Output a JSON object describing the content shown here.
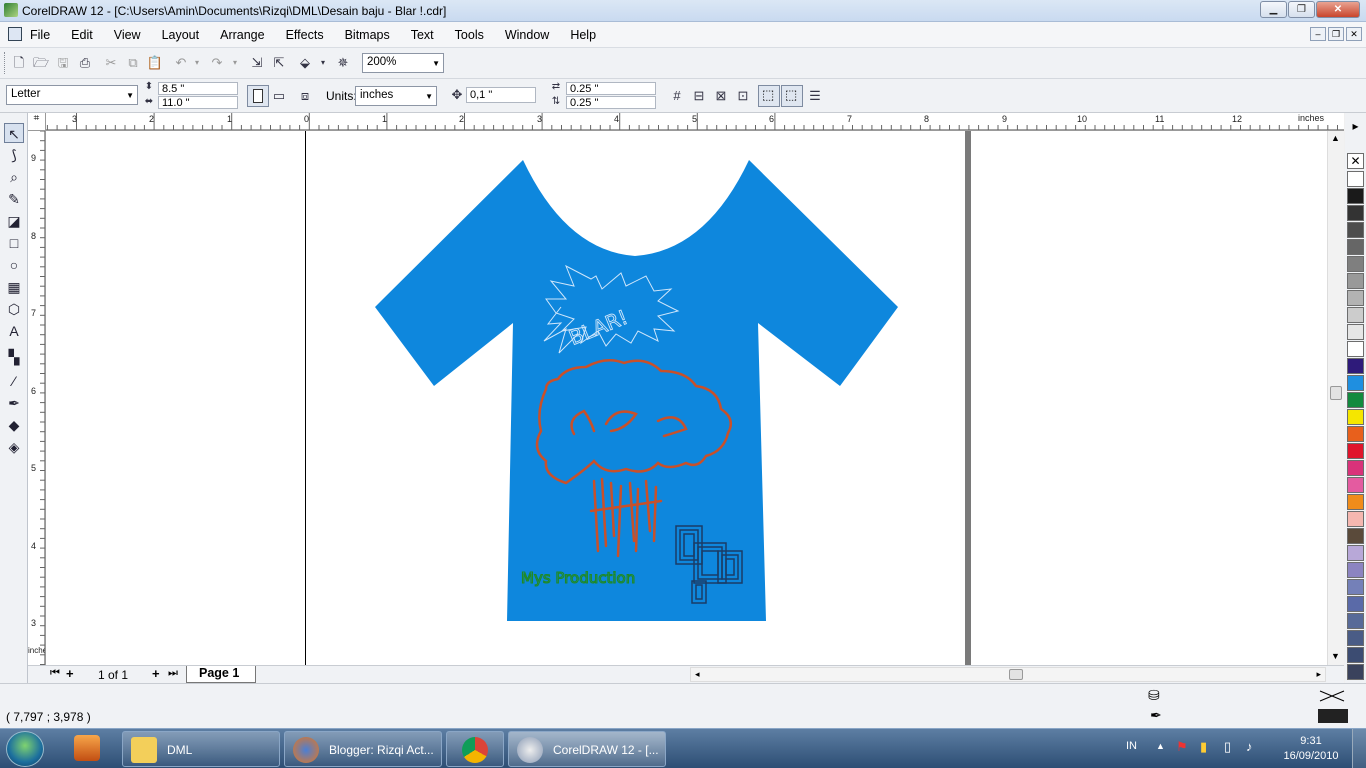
{
  "window": {
    "title": "CorelDRAW 12 - [C:\\Users\\Amin\\Documents\\Rizqi\\DML\\Desain baju - Blar !.cdr]",
    "minimize": "▁",
    "maximize": "❐",
    "close": "✕"
  },
  "menu": [
    "File",
    "Edit",
    "View",
    "Layout",
    "Arrange",
    "Effects",
    "Bitmaps",
    "Text",
    "Tools",
    "Window",
    "Help"
  ],
  "mdi": {
    "minimize": "–",
    "restore": "❐",
    "close": "✕"
  },
  "toolbar": {
    "zoom": "200%"
  },
  "property_bar": {
    "paper_size": "Letter",
    "width": "8.5 \"",
    "height": "11.0 \"",
    "units_label": "Units:",
    "units": "inches",
    "nudge": "0,1 \"",
    "dup_x": "0.25 \"",
    "dup_y": "0.25 \""
  },
  "ruler": {
    "h_ticks": [
      "3",
      "2",
      "1",
      "0",
      "1",
      "2",
      "3",
      "4",
      "5",
      "6",
      "7",
      "8",
      "9",
      "10",
      "11",
      "12"
    ],
    "h_units": "inches",
    "v_ticks": [
      "9",
      "8",
      "7",
      "6",
      "5",
      "4",
      "3"
    ],
    "v_units": "inches"
  },
  "artwork": {
    "shirt_color": "#0e87dd",
    "burst_text": "BLAR!",
    "brand_text": "Mys Production",
    "tree_color": "#c8502a",
    "brand_color": "#1f8a25"
  },
  "page_nav": {
    "count": "1 of 1",
    "tab": "Page 1"
  },
  "palette": [
    "#ffffff",
    "#1a1a1a",
    "#333333",
    "#4d4d4d",
    "#666666",
    "#7f7f7f",
    "#999999",
    "#b3b3b3",
    "#cccccc",
    "#e6e6e6",
    "#ffffff",
    "#2e1a7a",
    "#1f8fe0",
    "#138a3e",
    "#f5e600",
    "#e8601c",
    "#e0142b",
    "#d9327a",
    "#e45ba0",
    "#f08c1a",
    "#f5b7b0",
    "#5a4a3a",
    "#b8a8d8",
    "#8c84c0",
    "#7480b8",
    "#5a6aa8",
    "#586a98",
    "#4a5c86",
    "#3c4c72",
    "#3a425c"
  ],
  "status": {
    "coords": "( 7,797 ; 3,978 )"
  },
  "taskbar": {
    "tasks": [
      {
        "label": "DML"
      },
      {
        "label": "Blogger: Rizqi Act..."
      },
      {
        "label": ""
      },
      {
        "label": "CorelDRAW 12 - [..."
      }
    ],
    "lang": "IN",
    "time": "9:31",
    "date": "16/09/2010"
  }
}
